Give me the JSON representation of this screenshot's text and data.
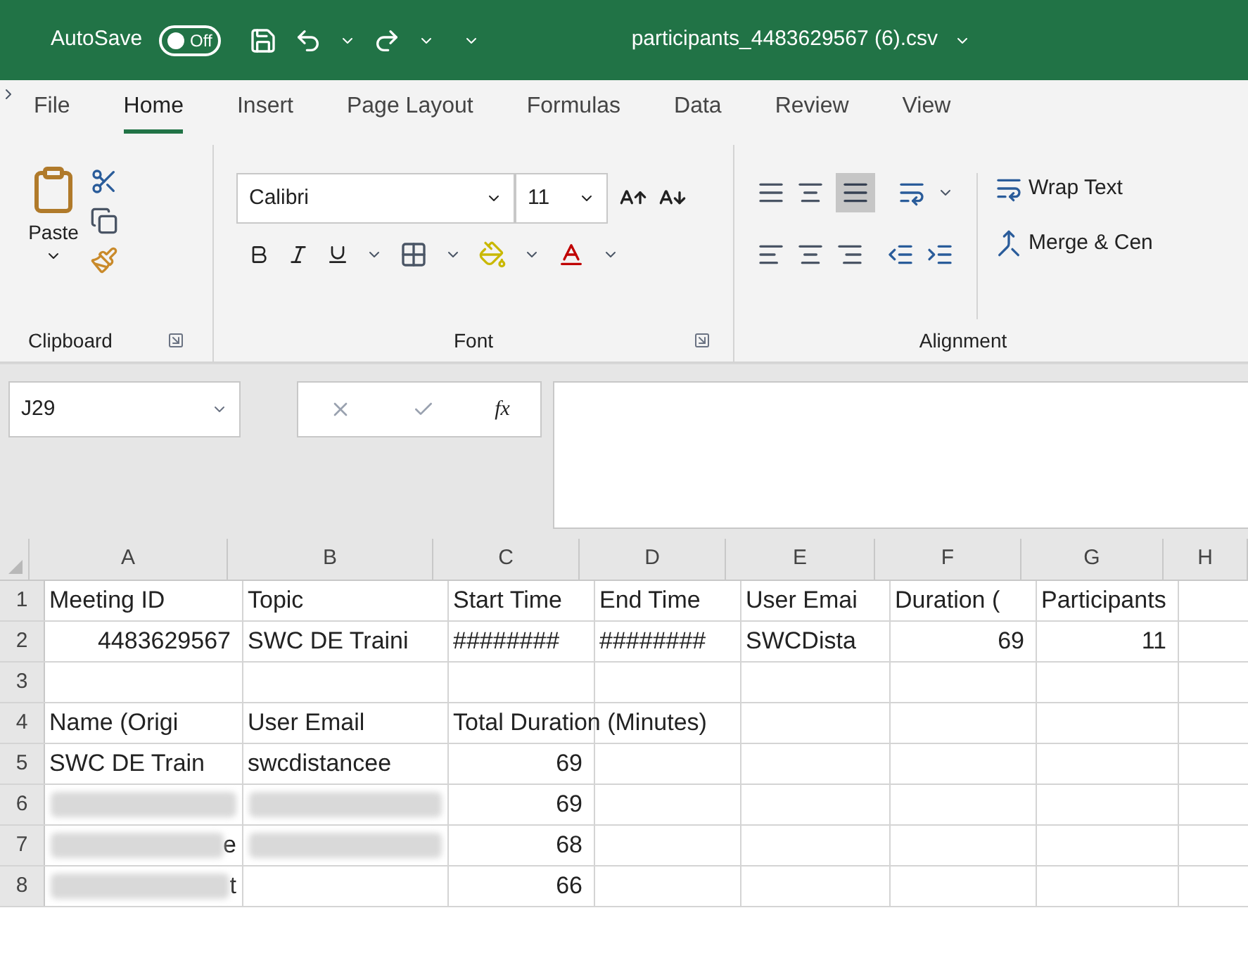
{
  "title_bar": {
    "autosave_label": "AutoSave",
    "autosave_toggle": {
      "label": "Off",
      "on": false
    },
    "file_name": "participants_4483629567 (6).csv"
  },
  "ribbon_tabs": [
    {
      "label": "File",
      "selected": false
    },
    {
      "label": "Home",
      "selected": true
    },
    {
      "label": "Insert",
      "selected": false
    },
    {
      "label": "Page Layout",
      "selected": false
    },
    {
      "label": "Formulas",
      "selected": false
    },
    {
      "label": "Data",
      "selected": false
    },
    {
      "label": "Review",
      "selected": false
    },
    {
      "label": "View",
      "selected": false
    }
  ],
  "ribbon": {
    "clipboard": {
      "paste_label": "Paste",
      "group_label": "Clipboard"
    },
    "font": {
      "font_name": "Calibri",
      "font_size": "11",
      "group_label": "Font"
    },
    "alignment": {
      "wrap_text": "Wrap Text",
      "merge": "Merge & Cen",
      "group_label": "Alignment"
    }
  },
  "formula_bar": {
    "name_box": "J29",
    "fx": "fx"
  },
  "sheet": {
    "columns": [
      "A",
      "B",
      "C",
      "D",
      "E",
      "F",
      "G",
      "H"
    ],
    "rows": [
      {
        "header": "1",
        "cells": [
          {
            "kind": "text",
            "text": "Meeting ID"
          },
          {
            "kind": "text",
            "text": "Topic"
          },
          {
            "kind": "text",
            "text": "Start Time"
          },
          {
            "kind": "text",
            "text": "End Time"
          },
          {
            "kind": "text",
            "text": "User Emai"
          },
          {
            "kind": "text",
            "text": "Duration ("
          },
          {
            "kind": "text",
            "text": "Participants"
          },
          null
        ]
      },
      {
        "header": "2",
        "cells": [
          {
            "kind": "number",
            "text": "4483629567"
          },
          {
            "kind": "text",
            "text": "SWC DE Traini"
          },
          {
            "kind": "text",
            "text": "########"
          },
          {
            "kind": "text",
            "text": "########"
          },
          {
            "kind": "text",
            "text": "SWCDista"
          },
          {
            "kind": "number",
            "text": "69"
          },
          {
            "kind": "number",
            "text": "11"
          },
          null
        ]
      },
      {
        "header": "3",
        "cells": [
          null,
          null,
          null,
          null,
          null,
          null,
          null,
          null
        ]
      },
      {
        "header": "4",
        "cells": [
          {
            "kind": "text",
            "text": "Name (Origi"
          },
          {
            "kind": "text",
            "text": "User Email"
          },
          {
            "kind": "text",
            "text": "Total Duration (Minutes)"
          },
          null,
          null,
          null,
          null,
          null
        ]
      },
      {
        "header": "5",
        "cells": [
          {
            "kind": "text",
            "text": "SWC DE Train"
          },
          {
            "kind": "text",
            "text": "swcdistancee"
          },
          {
            "kind": "number",
            "text": "69"
          },
          null,
          null,
          null,
          null,
          null
        ]
      },
      {
        "header": "6",
        "cells": [
          {
            "kind": "blurred"
          },
          {
            "kind": "blurred"
          },
          {
            "kind": "number",
            "text": "69"
          },
          null,
          null,
          null,
          null,
          null
        ]
      },
      {
        "header": "7",
        "cells": [
          {
            "kind": "blurred",
            "text": "e"
          },
          {
            "kind": "blurred"
          },
          {
            "kind": "number",
            "text": "68"
          },
          null,
          null,
          null,
          null,
          null
        ]
      },
      {
        "header": "8",
        "cells": [
          {
            "kind": "blurred",
            "text": "t"
          },
          null,
          {
            "kind": "number",
            "text": "66"
          },
          null,
          null,
          null,
          null,
          null
        ]
      }
    ]
  }
}
